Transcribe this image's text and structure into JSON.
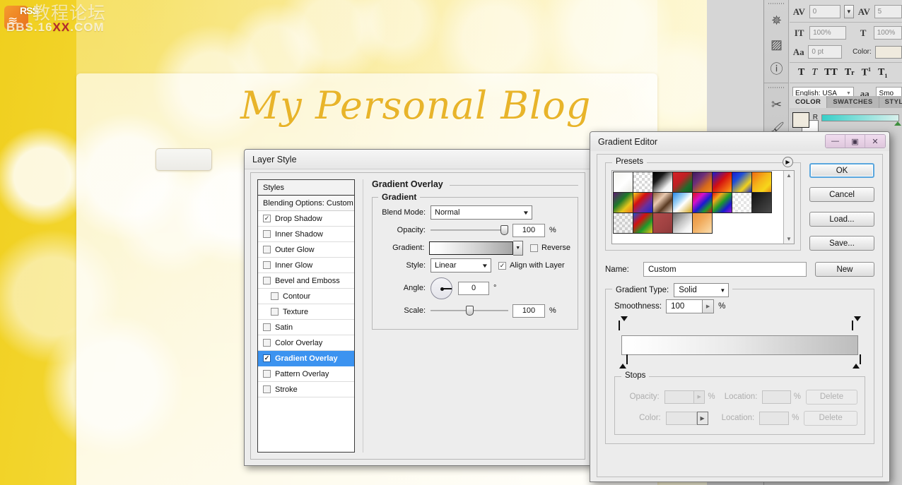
{
  "watermark": {
    "rss_label": "RSS",
    "chinese": "教程论坛",
    "domain_pre": "BBS.16",
    "domain_red": "XX",
    "domain_post": ".COM"
  },
  "document": {
    "site_title": "My Personal Blog"
  },
  "text_panel": {
    "tracking_icon": "AV",
    "tracking_value": "0",
    "kerning_icon": "AV",
    "kerning_value": "5",
    "vscale_icon": "IT",
    "vscale_value": "100%",
    "hscale_icon": "T",
    "hscale_value": "100%",
    "baseline_icon": "Aa",
    "baseline_value": "0 pt",
    "color_label": "Color:",
    "color_value": "#efeade",
    "styles": [
      "T",
      "T",
      "TT",
      "Tr",
      "T¹",
      "T₁"
    ],
    "language": "English: USA",
    "antialias_icon": "aa",
    "antialias_value": "Smo"
  },
  "color_panel": {
    "tabs": [
      "COLOR",
      "SWATCHES",
      "STYLES"
    ],
    "active_tab": "COLOR",
    "channel": "R",
    "foreground": "#efeade",
    "background": "#ffffff"
  },
  "rail_icons": [
    "compass-icon",
    "histogram-icon",
    "info-icon",
    "tools-icon",
    "brushes-icon"
  ],
  "layer_style": {
    "title": "Layer Style",
    "styles_header": "Styles",
    "blending_options": "Blending Options: Custom",
    "effects": [
      {
        "label": "Drop Shadow",
        "checked": true,
        "indent": false,
        "selected": false
      },
      {
        "label": "Inner Shadow",
        "checked": false,
        "indent": false,
        "selected": false
      },
      {
        "label": "Outer Glow",
        "checked": false,
        "indent": false,
        "selected": false
      },
      {
        "label": "Inner Glow",
        "checked": false,
        "indent": false,
        "selected": false
      },
      {
        "label": "Bevel and Emboss",
        "checked": false,
        "indent": false,
        "selected": false
      },
      {
        "label": "Contour",
        "checked": false,
        "indent": true,
        "selected": false
      },
      {
        "label": "Texture",
        "checked": false,
        "indent": true,
        "selected": false
      },
      {
        "label": "Satin",
        "checked": false,
        "indent": false,
        "selected": false
      },
      {
        "label": "Color Overlay",
        "checked": false,
        "indent": false,
        "selected": false
      },
      {
        "label": "Gradient Overlay",
        "checked": true,
        "indent": false,
        "selected": true
      },
      {
        "label": "Pattern Overlay",
        "checked": false,
        "indent": false,
        "selected": false
      },
      {
        "label": "Stroke",
        "checked": false,
        "indent": false,
        "selected": false
      }
    ],
    "panel_title": "Gradient Overlay",
    "group_title": "Gradient",
    "blend_mode_label": "Blend Mode:",
    "blend_mode_value": "Normal",
    "opacity_label": "Opacity:",
    "opacity_value": "100",
    "opacity_pct": "%",
    "gradient_label": "Gradient:",
    "reverse_label": "Reverse",
    "reverse_checked": false,
    "style_label": "Style:",
    "style_value": "Linear",
    "align_label": "Align with Layer",
    "align_checked": true,
    "angle_label": "Angle:",
    "angle_value": "0",
    "angle_unit": "°",
    "scale_label": "Scale:",
    "scale_value": "100",
    "scale_pct": "%"
  },
  "gradient_editor": {
    "title": "Gradient Editor",
    "window_buttons": [
      "minimize-icon",
      "maximize-icon",
      "close-icon"
    ],
    "presets_legend": "Presets",
    "presets_menu_icon": "preset-menu-arrow-icon",
    "preset_swatches": [
      "linear-gradient(135deg,#f5f5f0,#ffffff 55%,#e9e9e4)",
      "repeating-conic-gradient(#d8d8d8 0% 25%, #ffffff 0% 50%) 0 0/8px 8px",
      "linear-gradient(135deg,#000000,#1a1a1a 30%,#f2f2f2 72%,#ffffff)",
      "linear-gradient(135deg,#d42127 0%,#c01f24 40%,#1d6b2a 75%,#0f5f22 100%)",
      "linear-gradient(135deg,#3d1b5e,#6d2f7a 35%,#d86a1a 70%,#f08a1c)",
      "linear-gradient(135deg,#1a1ad1 0%,#d41010 45%,#f26b12 80%,#f5a91a)",
      "linear-gradient(135deg,#1a1ad1 0%,#1f4fd8 30%,#f2d21a 70%,#1a2ad1 100%)",
      "linear-gradient(135deg,#f06a12 0%,#f5b61a 45%,#f7d61a 75%,#e88a12 100%)",
      "linear-gradient(135deg,#5b1a6e 0%,#1d7a2a 40%,#e8c61a 70%,#f0721a 100%)",
      "linear-gradient(135deg,#f2d21a 0%,#d41010 35%,#6d2f9a 65%,#1a2ad1 100%)",
      "linear-gradient(135deg,#8a5a3a 0%,#e8c9b0 35%,#5a3a22 65%,#e0cfc0 100%)",
      "linear-gradient(135deg,#2a8ae8 0%,#9fd2f5 35%,#ffffff 55%,#d2a41a 100%)",
      "linear-gradient(135deg,#e01010 0%,#d410c8 30%,#1a1ad1 55%,#1d9a2a 78%,#e01010 100%)",
      "linear-gradient(135deg,#e01010,#f2a81a 25%,#1d9a2a 50%,#1a1ad1 75%,#9a1ad4)",
      "repeating-conic-gradient(#e4e4e4 0% 25%, #ffffff 0% 50%) 0 0/8px 8px",
      "linear-gradient(135deg,#111111,#2e2e2e 50%,#4a4a4a 100%)",
      "repeating-conic-gradient(#cfcfcf 0% 25%, #f2f2f2 0% 50%) 0 0/8px 8px",
      "linear-gradient(135deg,#1a4fd8 0%,#d41010 35%,#1d9a2a 65%,#f2c21a 100%)",
      "linear-gradient(135deg,#b24b4b,#a04242 60%,#8e3a3a)",
      "linear-gradient(135deg,#6a6a6a 0%,#c4c4c4 45%,#f2f2f2 75%,#ffffff 100%)",
      "linear-gradient(135deg,#e8903a 0%,#f0a95a 40%,#f7c98a 75%,#fadcb0 100%)"
    ],
    "buttons": {
      "ok": "OK",
      "cancel": "Cancel",
      "load": "Load...",
      "save": "Save...",
      "new": "New"
    },
    "name_label": "Name:",
    "name_value": "Custom",
    "gradient_type_label": "Gradient Type:",
    "gradient_type_value": "Solid",
    "smoothness_label": "Smoothness:",
    "smoothness_value": "100",
    "smoothness_pct": "%",
    "stops_legend": "Stops",
    "opacity_label": "Opacity:",
    "opacity_value": "",
    "opacity_pct": "%",
    "opacity_location_label": "Location:",
    "opacity_location_value": "",
    "opacity_location_pct": "%",
    "delete_opacity": "Delete",
    "color_label": "Color:",
    "color_location_label": "Location:",
    "color_location_value": "",
    "color_location_pct": "%",
    "delete_color": "Delete"
  },
  "colors": {
    "accent_blue": "#3c93f0",
    "dialog_bg": "#ececec",
    "doc_yellow": "#f0cf1e",
    "title_gold": "#e8b42a"
  }
}
